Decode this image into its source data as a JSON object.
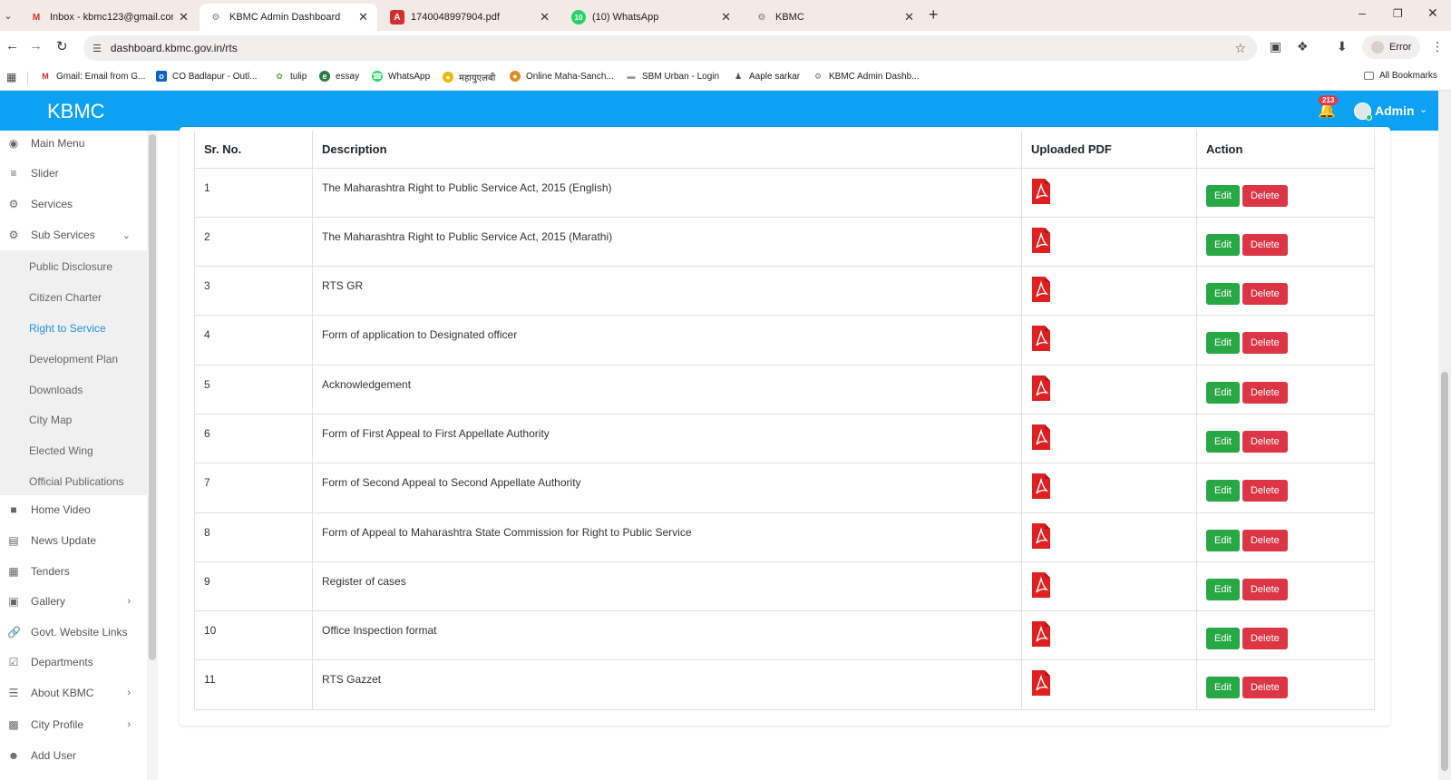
{
  "browser": {
    "tabs": [
      {
        "title": "Inbox - kbmc123@gmail.com -",
        "icon": "gmail-icon",
        "active": false
      },
      {
        "title": "KBMC Admin Dashboard",
        "icon": "kbmc-icon",
        "active": true
      },
      {
        "title": "1740048997904.pdf",
        "icon": "pdf-icon",
        "active": false
      },
      {
        "title": "(10) WhatsApp",
        "icon": "whatsapp-icon",
        "active": false
      },
      {
        "title": "KBMC",
        "icon": "kbmc-icon",
        "active": false
      }
    ],
    "url": "dashboard.kbmc.gov.in/rts",
    "profile_label": "Error",
    "bookmarks": [
      {
        "label": "Gmail: Email from G...",
        "icon": "gmail-icon"
      },
      {
        "label": "CO Badlapur - Outl...",
        "icon": "outlook-icon"
      },
      {
        "label": "tulip",
        "icon": "tulip-icon"
      },
      {
        "label": "essay",
        "icon": "essay-icon"
      },
      {
        "label": "WhatsApp",
        "icon": "whatsapp-icon"
      },
      {
        "label": "महायुएलबी",
        "icon": "mahayu-icon"
      },
      {
        "label": "Online Maha-Sanch...",
        "icon": "maha-icon"
      },
      {
        "label": "SBM Urban - Login",
        "icon": "sbm-icon"
      },
      {
        "label": "Aaple sarkar",
        "icon": "aaple-icon"
      },
      {
        "label": "KBMC Admin Dashb...",
        "icon": "kbmc-icon"
      }
    ],
    "all_bookmarks": "All Bookmarks"
  },
  "header": {
    "brand": "KBMC",
    "notification_count": "213",
    "user": "Admin",
    "accent": "#0da1f3"
  },
  "sidebar": {
    "items": [
      {
        "label": "Main Menu",
        "icon": "dashboard-icon"
      },
      {
        "label": "Slider",
        "icon": "sliders-icon"
      },
      {
        "label": "Services",
        "icon": "cogs-icon"
      },
      {
        "label": "Sub Services",
        "icon": "sub-services-icon",
        "expanded": true
      }
    ],
    "submenu": [
      "Public Disclosure",
      "Citizen Charter",
      "Right to Service",
      "Development Plan",
      "Downloads",
      "City Map",
      "Elected Wing",
      "Official Publications"
    ],
    "active_submenu": "Right to Service",
    "items_after": [
      {
        "label": "Home Video",
        "icon": "video-icon"
      },
      {
        "label": "News Update",
        "icon": "news-icon"
      },
      {
        "label": "Tenders",
        "icon": "calendar-icon"
      },
      {
        "label": "Gallery",
        "icon": "image-icon",
        "has_children": true
      },
      {
        "label": "Govt. Website Links",
        "icon": "link-icon"
      },
      {
        "label": "Departments",
        "icon": "calendar-check-icon"
      },
      {
        "label": "About KBMC",
        "icon": "list-icon",
        "has_children": true
      },
      {
        "label": "City Profile",
        "icon": "grid-icon",
        "has_children": true
      },
      {
        "label": "Add User",
        "icon": "user-icon"
      }
    ]
  },
  "table": {
    "headers": [
      "Sr. No.",
      "Description",
      "Uploaded PDF",
      "Action"
    ],
    "edit_label": "Edit",
    "delete_label": "Delete",
    "rows": [
      {
        "sr": "1",
        "description": "The Maharashtra Right to Public Service Act, 2015 (English)"
      },
      {
        "sr": "2",
        "description": "The Maharashtra Right to Public Service Act, 2015 (Marathi)"
      },
      {
        "sr": "3",
        "description": "RTS GR"
      },
      {
        "sr": "4",
        "description": "Form of application to Designated officer"
      },
      {
        "sr": "5",
        "description": "Acknowledgement"
      },
      {
        "sr": "6",
        "description": "Form of First Appeal to First Appellate Authority"
      },
      {
        "sr": "7",
        "description": "Form of Second Appeal to Second Appellate Authority"
      },
      {
        "sr": "8",
        "description": "Form of Appeal to Maharashtra State Commission for Right to Public Service"
      },
      {
        "sr": "9",
        "description": "Register of cases"
      },
      {
        "sr": "10",
        "description": "Office Inspection format"
      },
      {
        "sr": "11",
        "description": "RTS Gazzet"
      }
    ]
  },
  "colors": {
    "edit": "#28a745",
    "delete": "#dc3545",
    "pdf": "#e02020",
    "active_link": "#1e90e6"
  }
}
